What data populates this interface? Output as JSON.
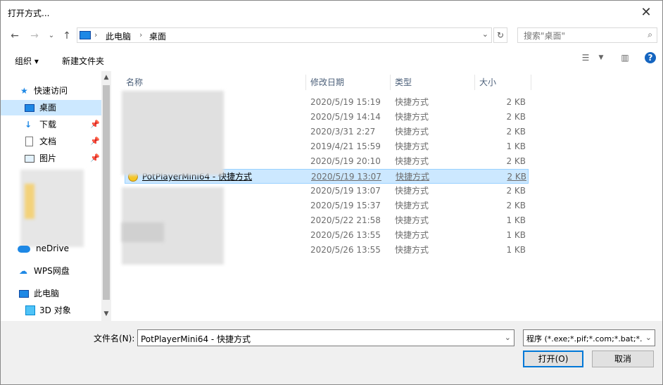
{
  "window": {
    "title": "打开方式..."
  },
  "address": {
    "crumbs": [
      "此电脑",
      "桌面"
    ]
  },
  "search": {
    "placeholder": "搜索\"桌面\""
  },
  "toolbar": {
    "organize": "组织 ▾",
    "new_folder": "新建文件夹"
  },
  "nav": {
    "quick_access": "快速访问",
    "items": [
      {
        "label": "桌面",
        "selected": true,
        "icon": "desktop-icon"
      },
      {
        "label": "下载",
        "icon": "download-icon",
        "pinned": true
      },
      {
        "label": "文档",
        "icon": "document-icon",
        "pinned": true
      },
      {
        "label": "图片",
        "icon": "picture-icon",
        "pinned": true
      }
    ],
    "onedrive": "neDrive",
    "wps": "WPS网盘",
    "this_pc": "此电脑",
    "objects3d": "3D 对象"
  },
  "columns": {
    "name": "名称",
    "date": "修改日期",
    "type": "类型",
    "size": "大小"
  },
  "files": [
    {
      "name": "",
      "date": "2020/5/19 15:19",
      "type": "快捷方式",
      "size": "2 KB"
    },
    {
      "name": "",
      "date": "2020/5/19 14:14",
      "type": "快捷方式",
      "size": "2 KB"
    },
    {
      "name": "",
      "date": "2020/3/31 2:27",
      "type": "快捷方式",
      "size": "2 KB"
    },
    {
      "name": "",
      "date": "2019/4/21 15:59",
      "type": "快捷方式",
      "size": "1 KB"
    },
    {
      "name": "",
      "date": "2020/5/19 20:10",
      "type": "快捷方式",
      "size": "2 KB"
    },
    {
      "name": "PotPlayerMini64 - 快捷方式",
      "date": "2020/5/19 13:07",
      "type": "快捷方式",
      "size": "2 KB",
      "selected": true
    },
    {
      "name": "",
      "date": "2020/5/19 13:07",
      "type": "快捷方式",
      "size": "2 KB"
    },
    {
      "name": "",
      "date": "2020/5/19 15:37",
      "type": "快捷方式",
      "size": "2 KB"
    },
    {
      "name": "",
      "date": "2020/5/22 21:58",
      "type": "快捷方式",
      "size": "1 KB"
    },
    {
      "name": "",
      "date": "2020/5/26 13:55",
      "type": "快捷方式",
      "size": "1 KB"
    },
    {
      "name": "",
      "date": "2020/5/26 13:55",
      "type": "快捷方式",
      "size": "1 KB"
    }
  ],
  "footer": {
    "filename_label": "文件名(N):",
    "filename_value": "PotPlayerMini64 - 快捷方式",
    "filter_value": "程序 (*.exe;*.pif;*.com;*.bat;*.",
    "open_label": "打开(O)",
    "cancel_label": "取消"
  },
  "colors": {
    "selection": "#cce8ff",
    "accent": "#0078d7"
  }
}
